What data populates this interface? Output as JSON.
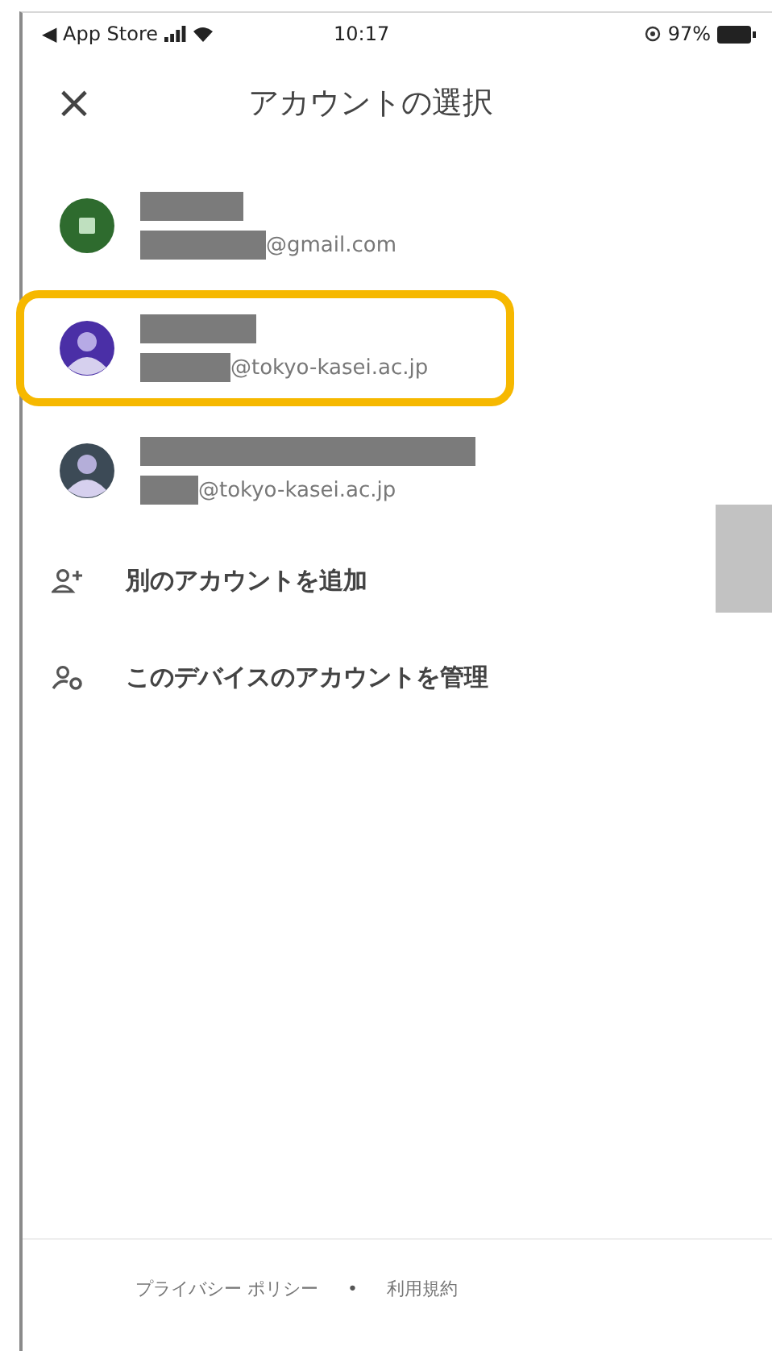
{
  "status_bar": {
    "back": "◀ App Store",
    "time": "10:17",
    "battery": "97%"
  },
  "header": {
    "close": "×",
    "title": "アカウントの選択"
  },
  "accounts": [
    {
      "kind": "letter",
      "color": "#2e6b2e",
      "email_suffix": "@gmail.com",
      "selected": false
    },
    {
      "kind": "person",
      "color": "#4a2fa6",
      "email_suffix": "@tokyo-kasei.ac.jp",
      "selected": true
    },
    {
      "kind": "person",
      "color": "#3c4a56",
      "email_suffix": "@tokyo-kasei.ac.jp",
      "selected": false
    }
  ],
  "actions": [
    {
      "kind": "add",
      "label": "別のアカウントを追加"
    },
    {
      "kind": "manage",
      "label": "このデバイスのアカウントを管理"
    }
  ],
  "footer": {
    "links": [
      "プライバシー ポリシー",
      "利用規約"
    ],
    "separator": "•"
  }
}
